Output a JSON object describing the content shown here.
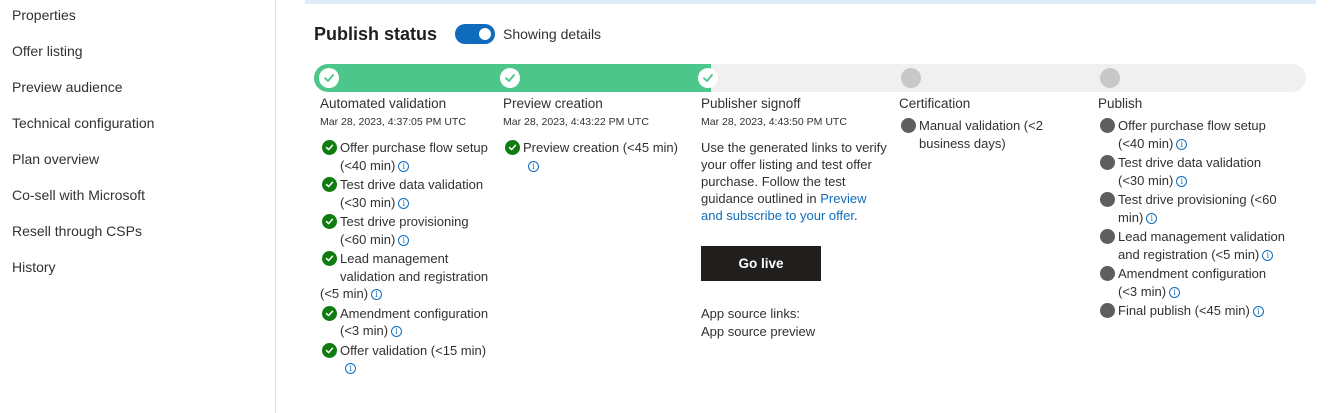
{
  "sidebar": {
    "items": [
      {
        "label": "Properties"
      },
      {
        "label": "Offer listing"
      },
      {
        "label": "Preview audience"
      },
      {
        "label": "Technical configuration"
      },
      {
        "label": "Plan overview"
      },
      {
        "label": "Co-sell with Microsoft"
      },
      {
        "label": "Resell through CSPs"
      },
      {
        "label": "History"
      }
    ]
  },
  "header": {
    "title": "Publish status",
    "toggle_label": "Showing details",
    "toggle_on": true
  },
  "colors": {
    "progress_done": "#4cc68a",
    "progress_track": "#f0f0f0",
    "accent": "#0f6cbd",
    "success": "#107c10",
    "pending": "#605e5c",
    "button": "#201f1e"
  },
  "stages": [
    {
      "title": "Automated validation",
      "time": "Mar 28, 2023, 4:37:05 PM UTC",
      "status": "complete",
      "tasks": [
        {
          "l1": "Offer purchase flow setup",
          "l2": "(<40 min)"
        },
        {
          "l1": "Test drive data validation",
          "l2": "(<30 min)"
        },
        {
          "l1": "Test drive provisioning",
          "l2": "(<60 min)"
        },
        {
          "l1": "Lead management",
          "l2": "validation and registration",
          "l3": "(<5 min)"
        },
        {
          "l1": "Amendment configuration",
          "l2": "(<3 min)"
        },
        {
          "l1": "Offer validation (<15 min)"
        }
      ]
    },
    {
      "title": "Preview creation",
      "time": "Mar 28, 2023, 4:43:22 PM UTC",
      "status": "complete",
      "tasks": [
        {
          "l1": "Preview creation (<45 min)"
        }
      ]
    },
    {
      "title": "Publisher signoff",
      "time": "Mar 28, 2023, 4:43:50 PM UTC",
      "status": "complete",
      "description": [
        "Use the generated links to verify",
        "your offer listing and test offer",
        "purchase. Follow the test",
        "guidance outlined in "
      ],
      "link_inline": "Preview",
      "link_line2": "and subscribe to your offer",
      "link_suffix": ".",
      "button_label": "Go live",
      "links_heading": "App source links:",
      "preview_link": "App source preview"
    },
    {
      "title": "Certification",
      "status": "pending",
      "tasks": [
        {
          "l1": "Manual validation (<2",
          "l2": "business days)"
        }
      ]
    },
    {
      "title": "Publish",
      "status": "pending",
      "tasks": [
        {
          "l1": "Offer purchase flow setup",
          "l2": "(<40 min)"
        },
        {
          "l1": "Test drive data validation",
          "l2": "(<30 min)"
        },
        {
          "l1": "Test drive provisioning (<60",
          "l2": "min)"
        },
        {
          "l1": "Lead management validation",
          "l2": "and registration (<5 min)"
        },
        {
          "l1": "Amendment configuration",
          "l2": "(<3 min)"
        },
        {
          "l1": "Final publish (<45 min)"
        }
      ]
    }
  ],
  "icons": {
    "info": "i"
  }
}
